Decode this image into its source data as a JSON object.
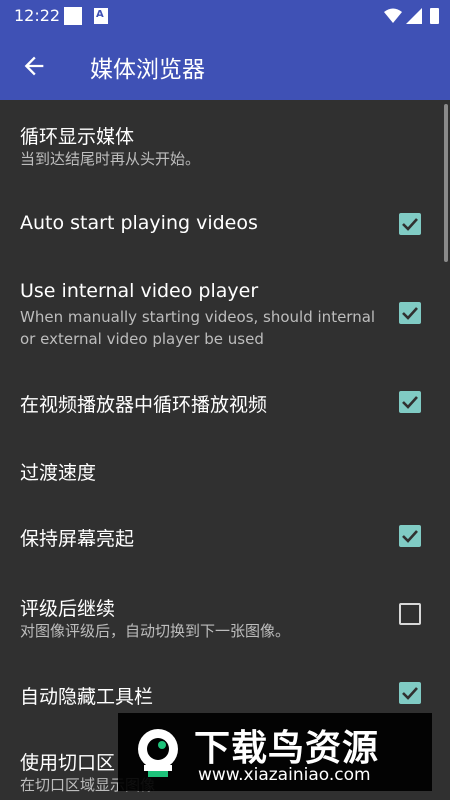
{
  "status_bar": {
    "time": "12:22",
    "notification_glyph": "A"
  },
  "app_bar": {
    "title": "媒体浏览器",
    "back_icon": "arrow-left-icon"
  },
  "settings": [
    {
      "title": "循环显示媒体",
      "summary": "当到达结尾时再从头开始。",
      "checkbox": null
    },
    {
      "title": "Auto start playing videos",
      "summary": "",
      "checkbox": true
    },
    {
      "title": "Use internal video player",
      "summary": "When manually starting videos, should internal or external video player be used",
      "checkbox": true
    },
    {
      "title": "在视频播放器中循环播放视频",
      "summary": "",
      "checkbox": true
    },
    {
      "title": "过渡速度",
      "summary": "",
      "checkbox": null
    },
    {
      "title": "保持屏幕亮起",
      "summary": "",
      "checkbox": true
    },
    {
      "title": "评级后继续",
      "summary": "对图像评级后，自动切换到下一张图像。",
      "checkbox": false
    },
    {
      "title": "自动隐藏工具栏",
      "summary": "",
      "checkbox": true
    },
    {
      "title": "使用切口区",
      "summary": "在切口区域显示图像",
      "checkbox": null
    }
  ],
  "watermark": {
    "title": "下载鸟资源",
    "url": "www.xiazainiao.com"
  },
  "colors": {
    "primary": "#3f51b5",
    "background": "#303030",
    "accent": "#80cbc4"
  }
}
